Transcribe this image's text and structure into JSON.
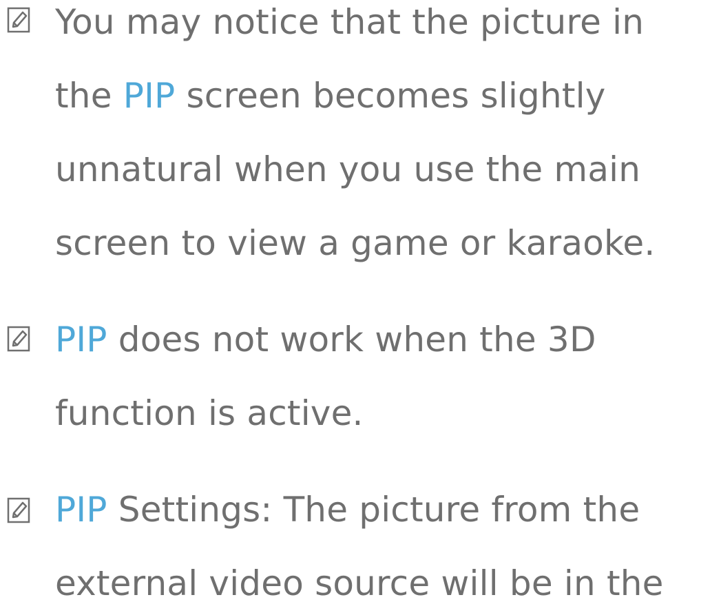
{
  "notes": [
    {
      "icon": "note-pencil-icon",
      "lines": [
        {
          "text": "You may notice that the picture in"
        },
        {
          "pre": "the ",
          "highlight": "PIP",
          "post": " screen becomes slightly"
        },
        {
          "text": "unnatural when you use the main"
        },
        {
          "text": "screen to view a game or karaoke."
        }
      ]
    },
    {
      "icon": "note-pencil-icon",
      "lines": [
        {
          "highlight": "PIP",
          "post": " does not work when the 3D"
        },
        {
          "text": "function is active."
        }
      ]
    },
    {
      "icon": "note-pencil-icon",
      "lines": [
        {
          "highlight": "PIP",
          "post": " Settings: The picture from the"
        },
        {
          "text": "external video source will be in the"
        }
      ]
    }
  ],
  "colors": {
    "text": "#6f6f6f",
    "highlight": "#4fa8d8"
  }
}
